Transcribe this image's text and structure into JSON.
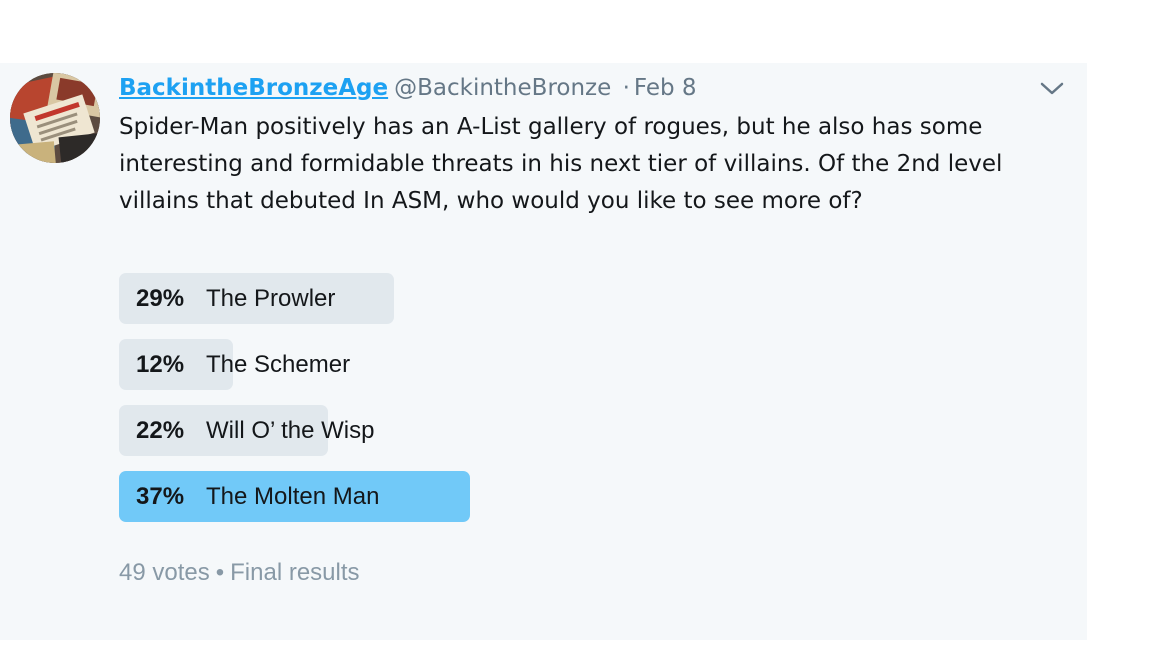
{
  "tweet": {
    "display_name": "BackintheBronzeAge",
    "handle": "@BackintheBronze",
    "separator": "·",
    "timestamp": "Feb 8",
    "caret_icon": "chevron-down-icon",
    "text": "Spider-Man positively has an A-List gallery of rogues, but he also has some interesting and formidable threats in his next tier of villains.  Of the 2nd level villains that debuted In ASM, who would you like to see more of?"
  },
  "poll": {
    "options": [
      {
        "percent_label": "29%",
        "label": "The Prowler",
        "percent": 29,
        "winner": false
      },
      {
        "percent_label": "12%",
        "label": "The Schemer",
        "percent": 12,
        "winner": false
      },
      {
        "percent_label": "22%",
        "label": "Will O’ the Wisp",
        "percent": 22,
        "winner": false
      },
      {
        "percent_label": "37%",
        "label": "The Molten Man",
        "percent": 37,
        "winner": true
      }
    ],
    "votes": "49 votes",
    "bullet": "•",
    "status": "Final results"
  },
  "colors": {
    "link": "#1da1f2",
    "bar": "#e1e8ed",
    "winner_bar": "#71c9f8",
    "card_bg": "#f5f8fa",
    "muted_text": "#657786"
  }
}
